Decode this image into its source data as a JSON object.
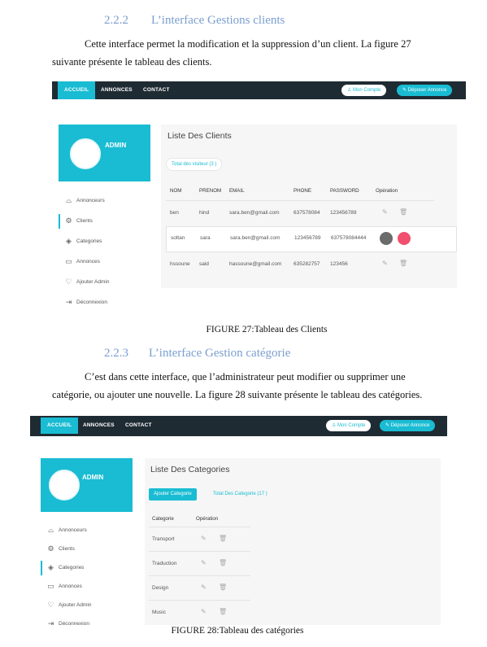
{
  "section1": {
    "number": "2.2.2",
    "title": "L’interface Gestions clients",
    "paragraph_line1": "Cette interface permet la modification et  la suppression  d’un client. La figure 27",
    "paragraph_line2": "suivante présente le tableau des clients."
  },
  "figure1": {
    "nav": {
      "items": [
        "ACCUEIL",
        "ANNONCES",
        "CONTACT"
      ],
      "account_button": "Mon Compte",
      "post_button": "Déposer Annonce"
    },
    "admin_label": "ADMIN",
    "sidebar": [
      "Annonceurs",
      "Clients",
      "Categories",
      "Annonces",
      "Ajouter Admin",
      "Déconnexion"
    ],
    "sidebar_icons": [
      "dashboard-icon",
      "gear-icon",
      "layers-icon",
      "megaphone-icon",
      "heart-icon",
      "logout-icon"
    ],
    "active_index": 1,
    "panel_title": "Liste Des Clients",
    "total_badge": "Total des visiteur (3 )",
    "columns": [
      "NOM",
      "PRENOM",
      "EMAIL",
      "PHONE",
      "PASSWORD",
      "Opération"
    ],
    "rows": [
      [
        "ben",
        "hind",
        "sara.ben@gmail.com",
        "637578084",
        "123456789"
      ],
      [
        "soltan",
        "sara",
        "sara.ben@gmail.com",
        "123456789",
        "637578084444"
      ],
      [
        "hssoune",
        "said",
        "hassoune@gmail.com",
        "635282757",
        "123456"
      ]
    ],
    "caption": "FIGURE 27:Tableau des Clients"
  },
  "section2": {
    "number": "2.2.3",
    "title": "L’interface Gestion catégorie",
    "paragraph_line1": "C’est dans cette interface, que l’administrateur peut modifier ou supprimer une",
    "paragraph_line2": "catégorie, ou ajouter une nouvelle.  La figure 28 suivante présente le tableau des catégories."
  },
  "figure2": {
    "nav": {
      "items": [
        "ACCUEIL",
        "ANNONCES",
        "CONTACT"
      ],
      "account_button": "Mon Compte",
      "post_button": "Déposer Annonce"
    },
    "admin_label": "ADMIN",
    "sidebar": [
      "Annonceurs",
      "Clients",
      "Categories",
      "Annonces",
      "Ajouter Admin",
      "Déconnexion"
    ],
    "active_index": 2,
    "panel_title": "Liste Des Categories",
    "add_button": "Ajouter Categorie",
    "total_badge": "Total Des Categorie (17 )",
    "columns": [
      "Categorie",
      "Opération"
    ],
    "rows": [
      "Transport",
      "Traduction",
      "Design",
      "Music"
    ],
    "caption": "FIGURE 28:Tableau des  catégories"
  },
  "colors": {
    "accent": "#19bcd2",
    "navbar": "#1f2b33",
    "heading": "#7a9ecf",
    "delete_red": "#f0506e"
  },
  "icons": {
    "edit": "pencil-icon",
    "delete": "trash-icon",
    "user": "user-icon",
    "post": "edit-square-icon"
  }
}
